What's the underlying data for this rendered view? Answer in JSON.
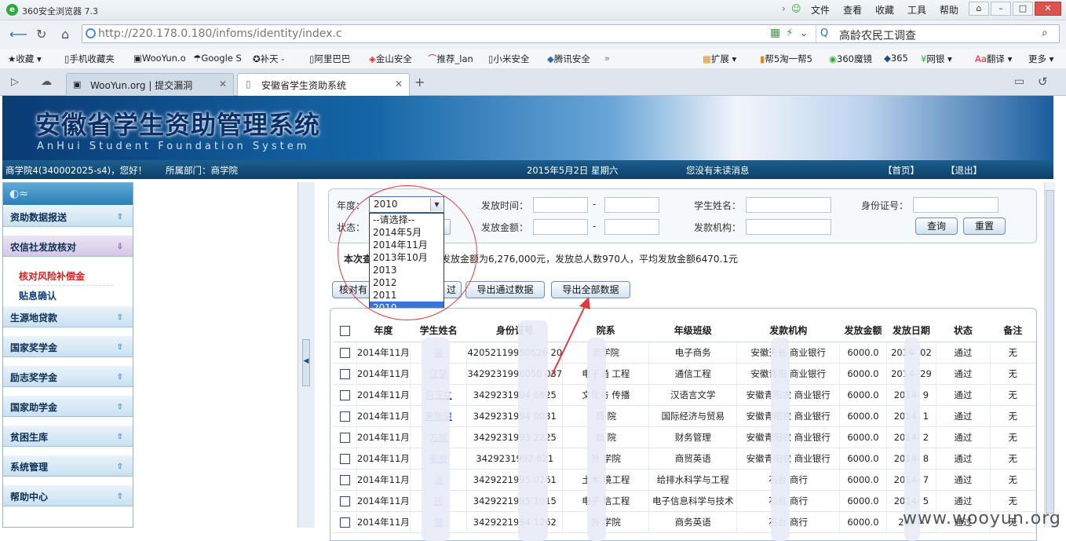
{
  "browser": {
    "title": "360安全浏览器 7.3",
    "menus": [
      "文件",
      "查看",
      "收藏",
      "工具",
      "帮助"
    ],
    "url_host": "http://220.178.0.180",
    "url_path": "/infoms/identity/index.c",
    "search_text": "高龄农民工调查",
    "bookmarks": [
      "收藏",
      "手机收藏夹",
      "WooYun.o",
      "Google S",
      "补天 -",
      "阿里巴巴",
      "金山安全",
      "推荐_lan",
      "小米安全",
      "腾讯安全"
    ],
    "bookmarks_right": [
      "扩展",
      "帮5淘一帮5",
      "360魔镜",
      "365",
      "网银",
      "翻译",
      "更多"
    ],
    "tabs": [
      {
        "label": "WooYun.org | 提交漏洞"
      },
      {
        "label": "安徽省学生资助系统"
      }
    ]
  },
  "banner": {
    "title": "安徽省学生资助管理系统",
    "subtitle": "AnHui Student Foundation System"
  },
  "status_bar": {
    "user": "商学院4(340002025-s4)，您好！",
    "dept": "所属部门：商学院",
    "date": "2015年5月2日 星期六",
    "message": "您没有未读消息",
    "home": "【首页】",
    "logout": "【退出】"
  },
  "sidebar": {
    "items": [
      {
        "label": "资助数据报送"
      },
      {
        "label": "农信社发放核对"
      },
      {
        "label": "生源地贷款"
      },
      {
        "label": "国家奖学金"
      },
      {
        "label": "励志奖学金"
      },
      {
        "label": "国家助学金"
      },
      {
        "label": "贫困生库"
      },
      {
        "label": "系统管理"
      },
      {
        "label": "帮助中心"
      }
    ],
    "subitems": [
      {
        "label": "核对风险补偿金",
        "color": "#d61e1e"
      },
      {
        "label": "贴息确认",
        "color": "#0e3f7d"
      }
    ]
  },
  "search": {
    "year_label": "年度：",
    "year_value": "2010",
    "status_label": "状态：",
    "issue_time_label": "发放时间：",
    "dash": "-",
    "amount_label": "发放金额：",
    "student_label": "学生姓名：",
    "bank_label": "发款机构：",
    "id_label": "身份证号：",
    "query_btn": "查询",
    "reset_btn": "重置",
    "year_options": [
      "--请选择--",
      "2014年5月",
      "2014年11月",
      "2013年10月",
      "2013",
      "2012",
      "2011",
      "2010"
    ],
    "selected_option": "2010"
  },
  "summary": {
    "bold": "本次查",
    "text": "发放金额为6,276,000元，发放总人数970人，平均发放金额6470.1元"
  },
  "actions": {
    "verify_btn": "核对有",
    "btn2_fragment": "过",
    "export_passed": "导出通过数据",
    "export_all": "导出全部数据"
  },
  "table": {
    "headers": [
      "年度",
      "学生姓名",
      "身份证号",
      "院系",
      "年级班级",
      "发款机构",
      "发放金额",
      "发放日期",
      "状态",
      "备注"
    ],
    "rows": [
      [
        "2014年11月",
        "梁",
        "420521199506",
        "20",
        "商学院",
        "电子商务",
        "安徽天长",
        "商业银行",
        "6000.0",
        "2014-",
        "02",
        "通过",
        "无"
      ],
      [
        "2014年11月",
        "汪梦",
        "342923199605",
        "037",
        "电子通",
        "工程",
        "通信工程",
        "安徽青阳",
        "商业银行",
        "6000.0",
        "2014-",
        "29",
        "通过",
        "无"
      ],
      [
        "2014年11月",
        "何玉立",
        "342923199410",
        "6625",
        "文化与",
        "传播",
        "汉语言文学",
        "安徽青阳农",
        "商业银行",
        "6000.0",
        "2014-",
        "9",
        "通过",
        "无"
      ]
    ]
  },
  "table_rows": [
    {
      "year": "2014年11月",
      "name": "梁",
      "id": "42052119950626 20",
      "dept": "商学院",
      "cls": "电子商务",
      "bank": "安徽天长 商业银行",
      "amt": "6000.0",
      "date": "2014-  02",
      "st": "通过",
      "rem": "无"
    },
    {
      "year": "2014年11月",
      "name": "汪梦",
      "id": "3429231996050 037",
      "dept": "电子通 工程",
      "cls": "通信工程",
      "bank": "安徽青阳 商业银行",
      "amt": "6000.0",
      "date": "2014-  29",
      "st": "通过",
      "rem": "无"
    },
    {
      "year": "2014年11月",
      "name": "何玉立",
      "id": "3429231994 6625",
      "dept": "文化与 传播",
      "cls": "汉语言文学",
      "bank": "安徽青阳农 商业银行",
      "amt": "6000.0",
      "date": "2014-  9",
      "st": "通过",
      "rem": "无"
    },
    {
      "year": "2014年11月",
      "name": "朱旭健",
      "id": "3429231994 0031",
      "dept": "商 院",
      "cls": "国际经济与贸易",
      "bank": "安徽青阳农 商业银行",
      "amt": "6000.0",
      "date": "2014-  1",
      "st": "通过",
      "rem": "无"
    },
    {
      "year": "2014年11月",
      "name": "方欣",
      "id": "3429231993 2225",
      "dept": "商 院",
      "cls": "财务管理",
      "bank": "安徽青阳农 商业银行",
      "amt": "6000.0",
      "date": "2014-  2",
      "st": "通过",
      "rem": "无"
    },
    {
      "year": "2014年11月",
      "name": "姜根",
      "id": "3429231992 621",
      "dept": "外 学院",
      "cls": "商贸英语",
      "bank": "安徽青阳农 商业银行",
      "amt": "6000.0",
      "date": "2014-  8",
      "st": "通过",
      "rem": "无"
    },
    {
      "year": "2014年11月",
      "name": "汤",
      "id": "3429221995 0261",
      "dept": "土木 境工程",
      "cls": "给排水科学与工程",
      "bank": "石台 商行",
      "amt": "6000.0",
      "date": "2014-  7",
      "st": "通过",
      "rem": "无"
    },
    {
      "year": "2014年11月",
      "name": "民",
      "id": "3429221995 1015",
      "dept": "电子 信工程",
      "cls": "电子信息科学与技术",
      "bank": "石台 商行",
      "amt": "6000.0",
      "date": "2014-  5",
      "st": "通过",
      "rem": "无"
    },
    {
      "year": "2014年11月",
      "name": "慧",
      "id": "3429221994 1262",
      "dept": "外 学院",
      "cls": "商务英语",
      "bank": "石台 商行",
      "amt": "6000.0",
      "date": "2014-",
      "st": "通过",
      "rem": "无"
    }
  ],
  "watermark": "www.wooyun.org"
}
